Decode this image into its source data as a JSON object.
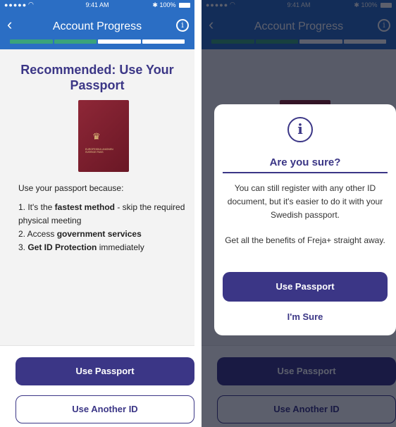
{
  "status_bar": {
    "carrier_dots": "●●●●●",
    "time": "9:41 AM",
    "battery": "100%"
  },
  "header": {
    "title": "Account Progress",
    "back_icon": "chevron-left-icon",
    "info_icon": "info-icon"
  },
  "progress": {
    "steps_total": 4,
    "steps_done": 2,
    "done_color": "#3aa37b"
  },
  "main": {
    "heading": "Recommended: Use Your Passport",
    "passport_text": "EUROPEISKA UNIONEN SVERIGE PASS",
    "intro": "Use your passport because:",
    "item1_prefix": "1. It's the ",
    "item1_bold": "fastest method",
    "item1_suffix": " - skip the required physical meeting",
    "item2_prefix": "2. Access ",
    "item2_bold": "government services",
    "item3_bold": "Get ID Protection",
    "item3_prefix": "3. ",
    "item3_suffix": " immediately"
  },
  "footer": {
    "primary_label": "Use Passport",
    "secondary_label": "Use Another ID"
  },
  "modal": {
    "icon": "info-icon",
    "title": "Are you sure?",
    "text": "You can still register with any other ID document, but it's easier to do it with your Swedish passport.",
    "text2": "Get all the benefits of Freja+ straight away.",
    "primary_label": "Use Passport",
    "secondary_label": "I'm Sure"
  },
  "colors": {
    "brand": "#3b3686",
    "header": "#2b6ec4"
  }
}
